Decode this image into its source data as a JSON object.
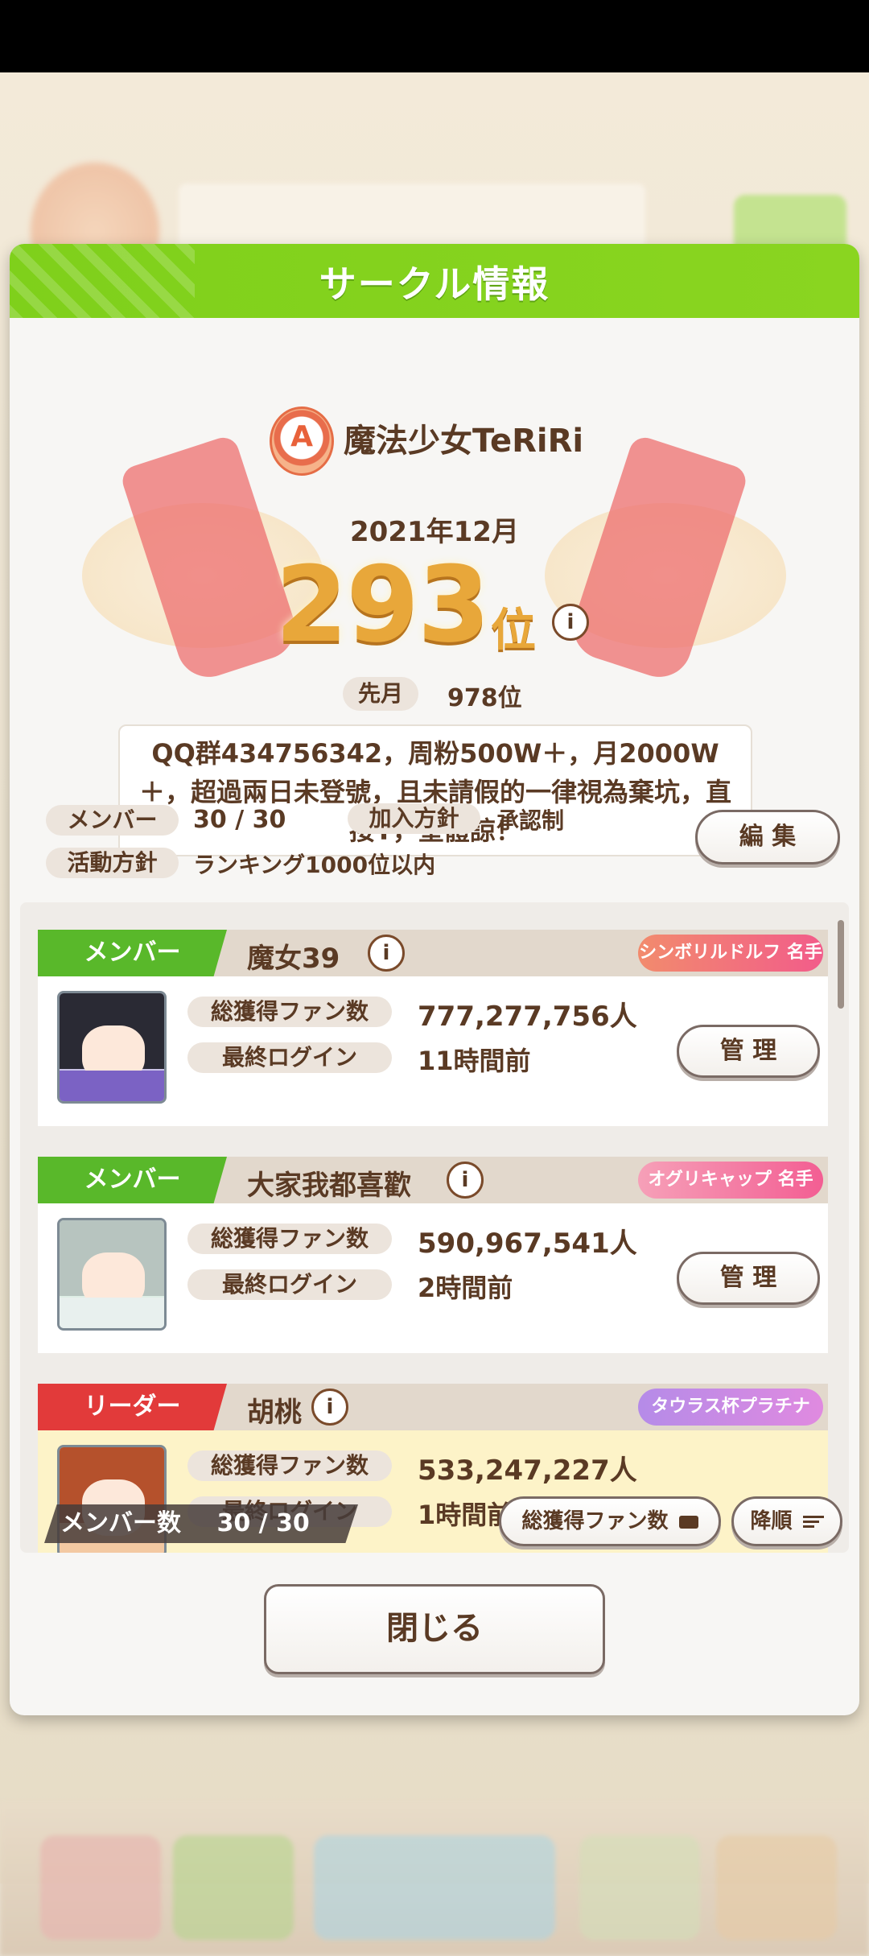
{
  "modal": {
    "title": "サークル情報",
    "circle_name": "魔法少女TeRiRi",
    "emblem_letter": "A",
    "month": "2021年12月",
    "rank_number": "293",
    "rank_unit": "位",
    "info_icon": "i",
    "last_month_label": "先月",
    "last_month_rank": "978位",
    "description": "QQ群434756342，周粉500W＋，月2000W＋，超過兩日未登號，且未請假的一律視為棄坑，直接T，望體諒！",
    "stats": {
      "member_label": "メンバー",
      "member_value": "30 / 30",
      "join_label": "加入方針",
      "join_value": "承認制",
      "activity_label": "活動方針",
      "activity_value": "ランキング1000位以内",
      "edit_button": "編 集"
    },
    "members": [
      {
        "role": "メンバー",
        "name": "魔女39",
        "title_badge": "シンボリルドルフ 名手",
        "fans_label": "総獲得ファン数",
        "fans_value": "777,277,756人",
        "login_label": "最終ログイン",
        "login_value": "11時間前",
        "manage_button": "管 理"
      },
      {
        "role": "メンバー",
        "name": "大家我都喜歡",
        "title_badge": "オグリキャップ 名手",
        "fans_label": "総獲得ファン数",
        "fans_value": "590,967,541人",
        "login_label": "最終ログイン",
        "login_value": "2時間前",
        "manage_button": "管 理"
      },
      {
        "role": "リーダー",
        "name": "胡桃",
        "title_badge": "タウラス杯プラチナ",
        "fans_label": "総獲得ファン数",
        "fans_value": "533,247,227人",
        "login_label": "最終ログイン",
        "login_value": "1時間前"
      }
    ],
    "footer": {
      "member_count_label": "メンバー数",
      "member_count_value": "30 / 30",
      "sort_key_button": "総獲得ファン数",
      "sort_order_button": "降順"
    },
    "close_button": "閉じる"
  },
  "colors": {
    "header_green": "#7fd01b",
    "member_green": "#59b82a",
    "leader_red": "#e23a3a",
    "rank_gold": "#e8a73a",
    "text_brown": "#5a3a24"
  }
}
